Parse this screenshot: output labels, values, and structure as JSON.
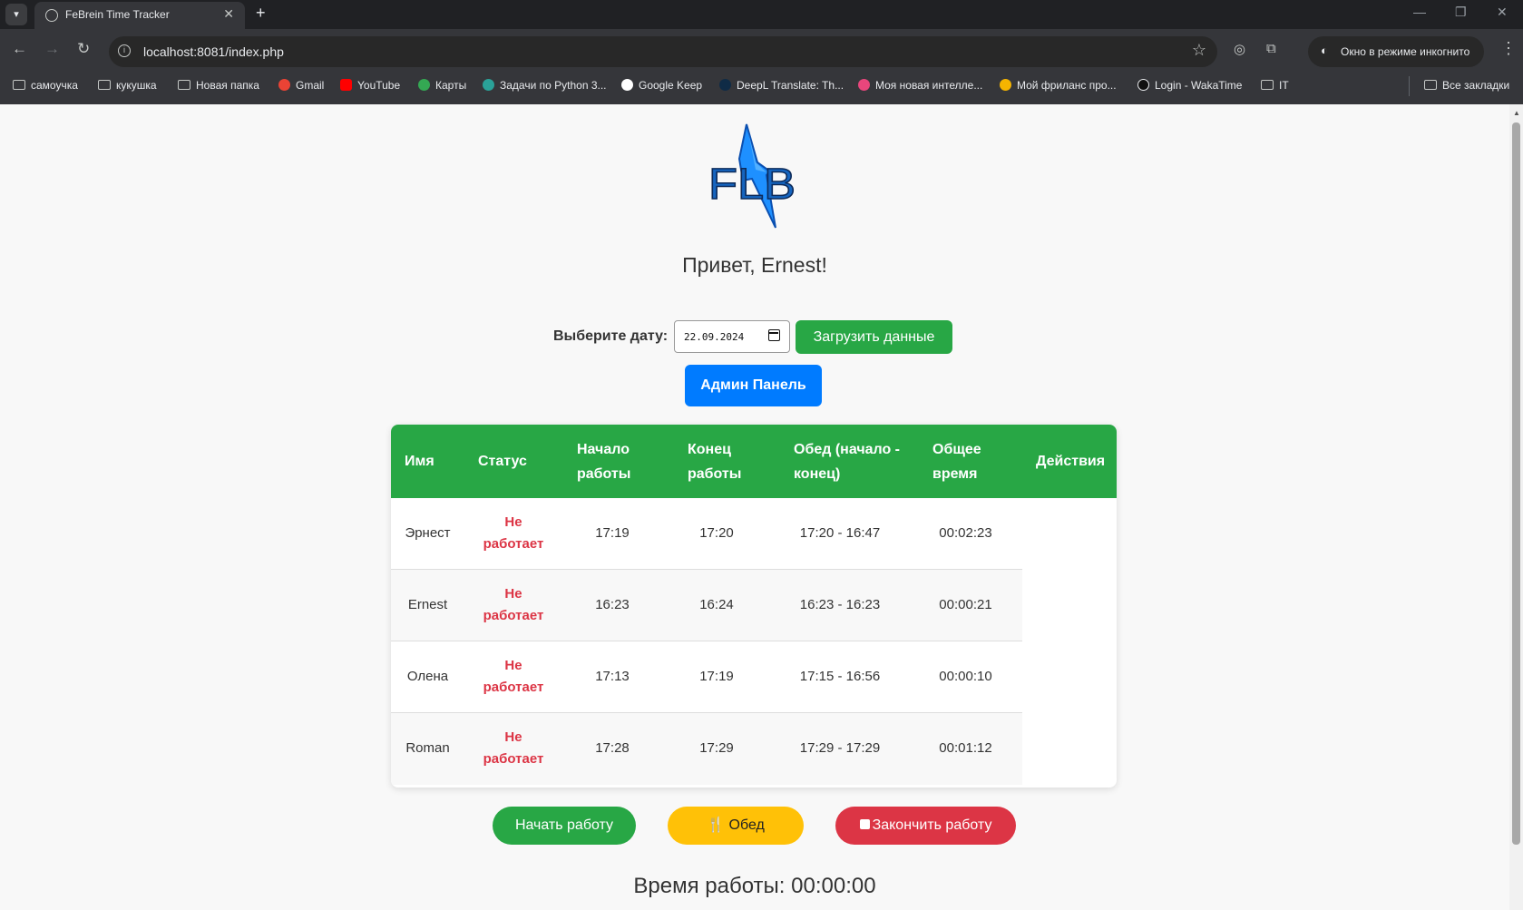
{
  "browser": {
    "tab_title": "FeBrein Time Tracker",
    "url": "localhost:8081/index.php",
    "incognito_label": "Окно в режиме инкогнито",
    "bookmarks": [
      "самоучка",
      "кукушка",
      "Новая папка",
      "Gmail",
      "YouTube",
      "Карты",
      "Задачи по Python 3...",
      "Google Keep",
      "DeepL Translate: Th...",
      "Моя новая интелле...",
      "Мой фриланс про...",
      "Login - WakaTime",
      "IT"
    ],
    "all_bookmarks": "Все закладки"
  },
  "app": {
    "logo_text": "FLB",
    "greeting": "Привет, Ernest!",
    "date_label": "Выберите дату:",
    "date_value": "22.09.2024",
    "load_button": "Загрузить данные",
    "admin_button": "Админ Панель"
  },
  "table": {
    "headers": [
      [
        "Имя"
      ],
      [
        "Статус"
      ],
      [
        "Начало",
        "работы"
      ],
      [
        "Конец",
        "работы"
      ],
      [
        "Обед (начало -",
        "конец)"
      ],
      [
        "Общее",
        "время"
      ],
      [
        "Действия"
      ]
    ],
    "rows": [
      {
        "name": "Эрнест",
        "status": [
          "Не",
          "работает"
        ],
        "start": "17:19",
        "end": "17:20",
        "lunch": "17:20 - 16:47",
        "total": "00:02:23"
      },
      {
        "name": "Ernest",
        "status": [
          "Не",
          "работает"
        ],
        "start": "16:23",
        "end": "16:24",
        "lunch": "16:23 - 16:23",
        "total": "00:00:21"
      },
      {
        "name": "Олена",
        "status": [
          "Не",
          "работает"
        ],
        "start": "17:13",
        "end": "17:19",
        "lunch": "17:15 - 16:56",
        "total": "00:00:10"
      },
      {
        "name": "Roman",
        "status": [
          "Не",
          "работает"
        ],
        "start": "17:28",
        "end": "17:29",
        "lunch": "17:29 - 17:29",
        "total": "00:01:12"
      }
    ]
  },
  "actions": {
    "start": "Начать работу",
    "lunch": "Обед",
    "end": "Закончить работу"
  },
  "work_time": "Время работы: 00:00:00",
  "colors": {
    "green": "#28a745",
    "blue": "#007bff",
    "yellow": "#ffc107",
    "red": "#dc3545"
  }
}
